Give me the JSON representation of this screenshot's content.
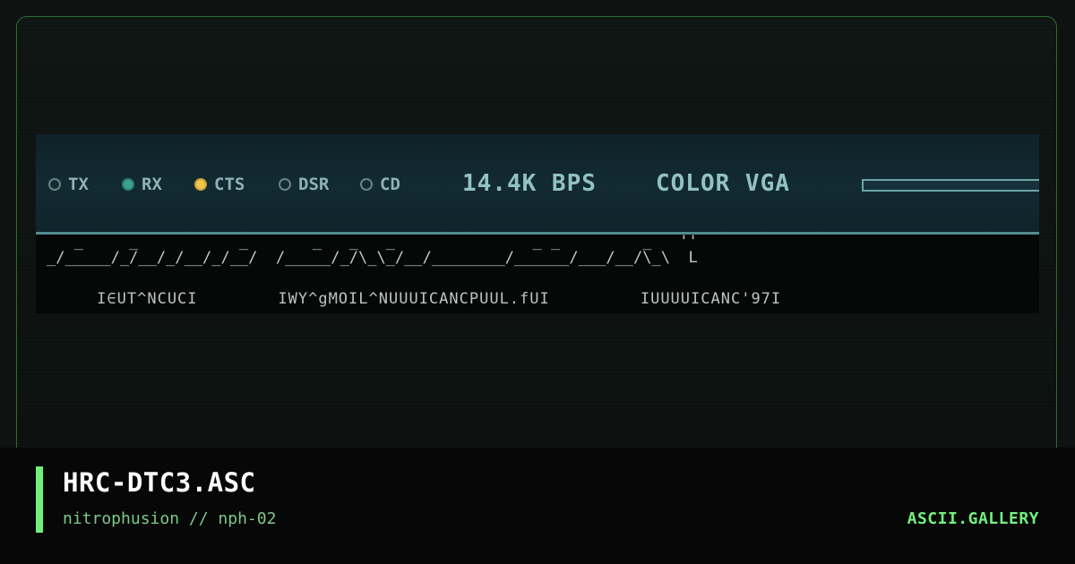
{
  "artwork": {
    "indicators": [
      {
        "label": "TX",
        "state": "off",
        "icon": "led-off-icon"
      },
      {
        "label": "RX",
        "state": "on",
        "color": "#3fa08c",
        "icon": "led-green-icon"
      },
      {
        "label": "CTS",
        "state": "on",
        "color": "#f0c74a",
        "icon": "led-yellow-icon"
      },
      {
        "label": "DSR",
        "state": "off",
        "icon": "led-off-icon"
      },
      {
        "label": "CD",
        "state": "off",
        "icon": "led-off-icon"
      }
    ],
    "speed": "14.4K BPS",
    "display_mode": "COLOR VGA",
    "ascii_row_1": "   _     _           _       _   _   _               _ _         _   ''",
    "ascii_row_2": "_/_____/_/__/_/__/_/__/  /_____/_/\\_\\_/__/________/______/___/__/\\_\\  L",
    "ascii_row_3": "     I∈UT^NCUCI        IWY^gMOIL^NUUUICANCPUUL.fUI         IUUUUICANC'97I"
  },
  "footer": {
    "title": "HRC-DTC3.ASC",
    "author": "nitrophusion // nph-02",
    "brand": "ASCII.GALLERY"
  },
  "colors": {
    "accent": "#6ef07a",
    "frame_border": "#2c6b36",
    "background": "#0e1211"
  }
}
